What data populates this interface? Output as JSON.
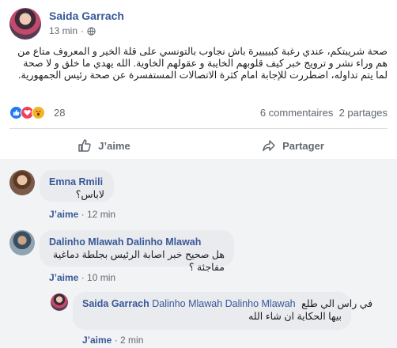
{
  "post": {
    "author": "Saida Garrach",
    "time": "13 min",
    "separator": "·",
    "text": "صحة شريبتكم، عندي رغبة كبييييرة باش نجاوب بالتونسي على قلة الخير و المعروف متاع من هم وراء نشر و ترويج خبر كيف قلوبهم الخايبة و عقولهم الخاوية. الله يهدي ما خلق و لا صحة لما يتم تداوله، اضطررت للإجابة امام كثرة الاتصالات المستفسرة عن صحة رئيس الجمهورية."
  },
  "reactions": {
    "count": "28",
    "comments": "6 commentaires",
    "shares": "2 partages",
    "colors": {
      "like": "#2078f4",
      "love": "#f33e58",
      "wow": "#f7b125"
    }
  },
  "actions": {
    "like": "J’aime",
    "share": "Partager"
  },
  "comments": [
    {
      "name": "Emna Rmili",
      "text": "لاباس؟",
      "like": "J’aime",
      "sep": "·",
      "time": "12 min"
    },
    {
      "name": "Dalinho Mlawah Dalinho Mlawah",
      "text": "هل صحيح خبر اصابة الرئيس بجلطة دماغية مفاجئة ؟",
      "like": "J’aime",
      "sep": "·",
      "time": "10 min"
    }
  ],
  "reply": {
    "name": "Saida Garrach",
    "mention": "Dalinho Mlawah Dalinho Mlawah",
    "text_line1": "في راس الي طلع",
    "text_line2": "بيها الحكاية ان شاء الله",
    "like": "J’aime",
    "sep": "·",
    "time": "2 min"
  }
}
